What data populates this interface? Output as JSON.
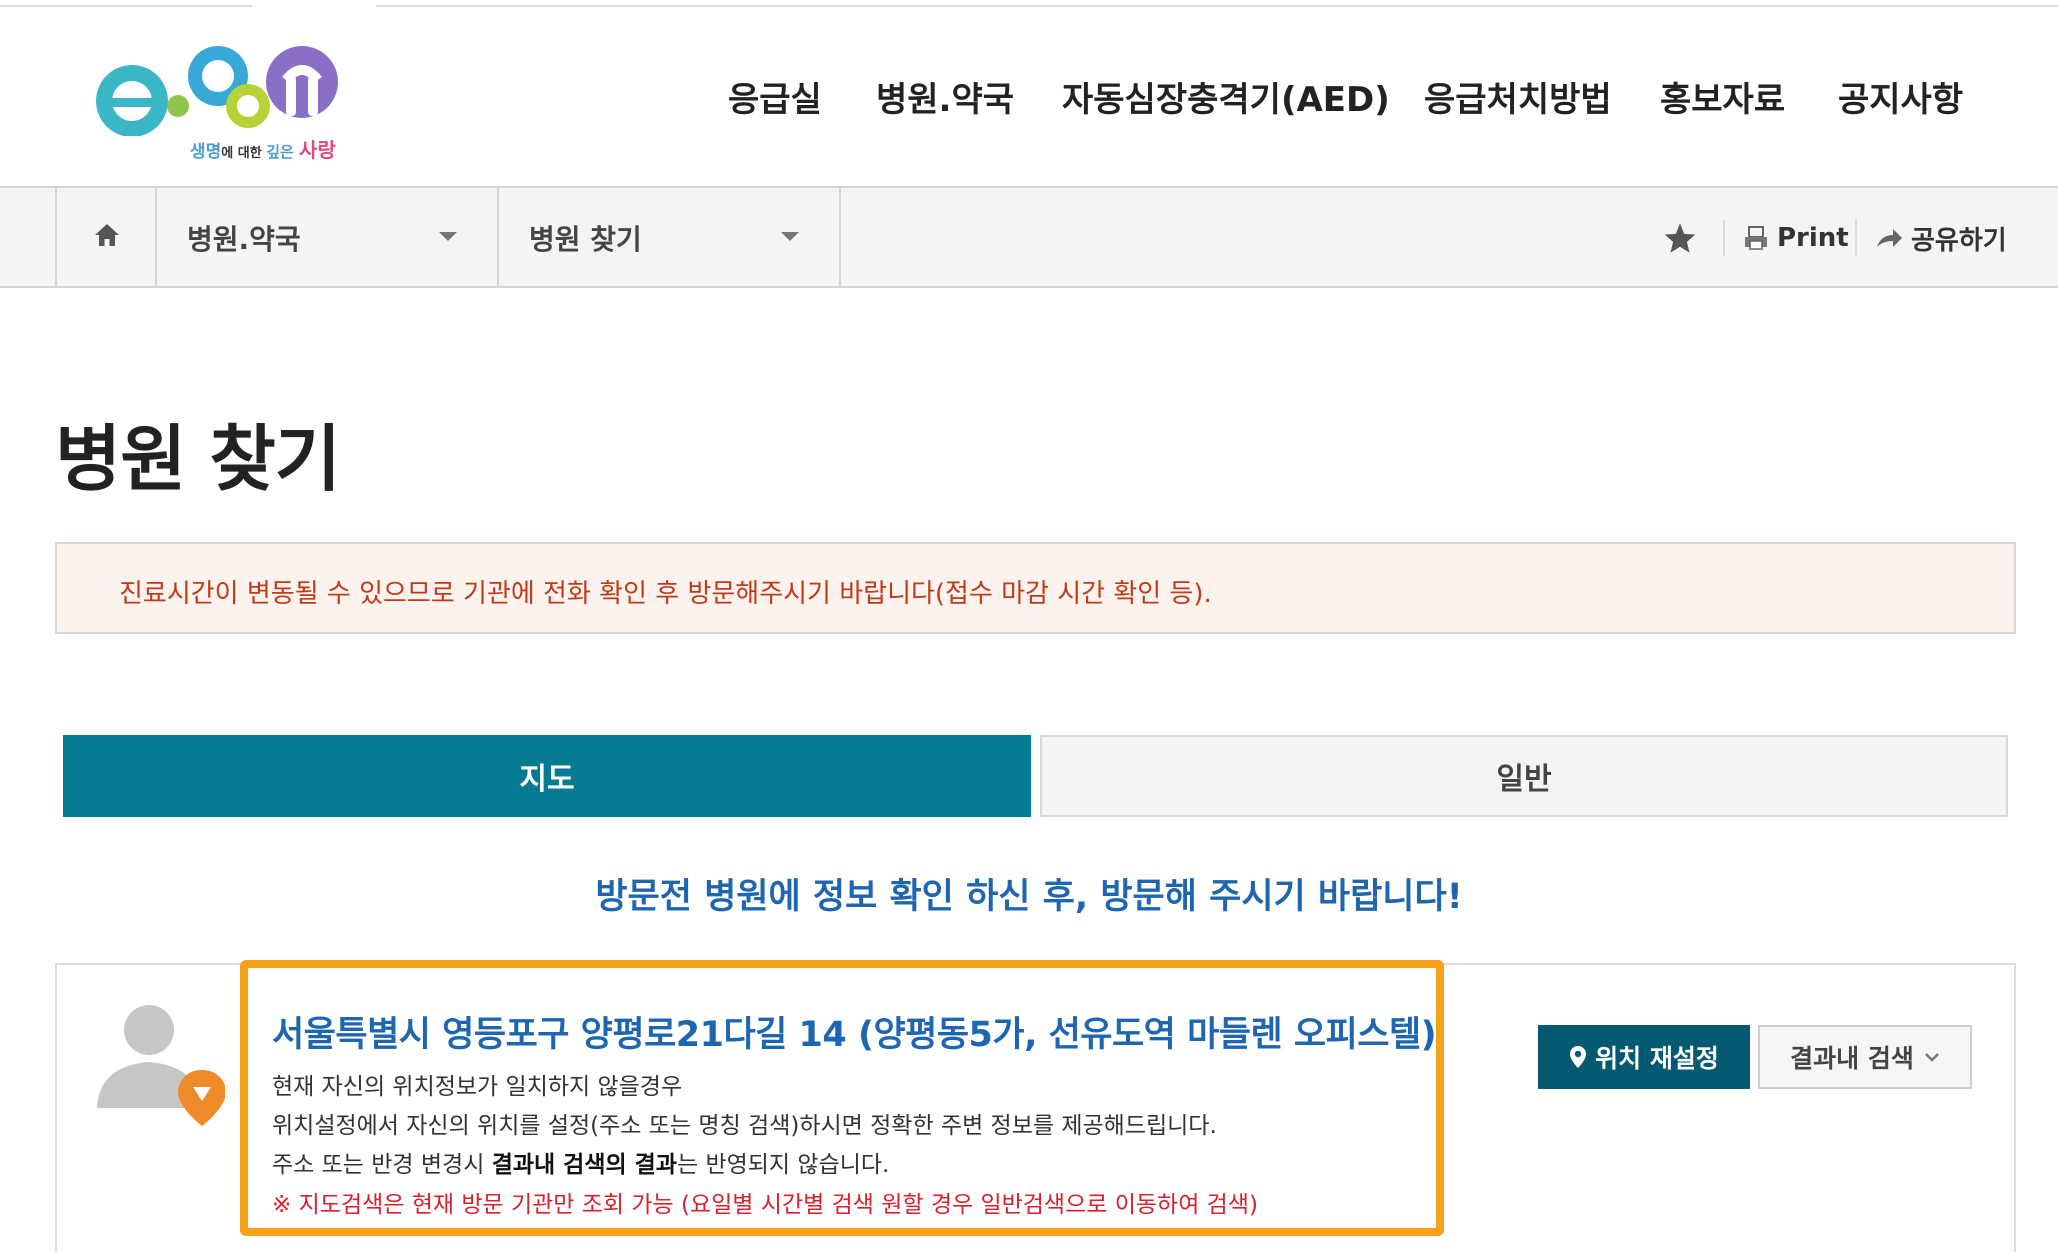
{
  "logo": {
    "tagline_part1": "생명",
    "tagline_part2": "에 대한 ",
    "tagline_part3": "깊은 ",
    "tagline_part4": "사랑"
  },
  "gnb": {
    "items": [
      {
        "label": "응급실"
      },
      {
        "label": "병원.약국"
      },
      {
        "label": "자동심장충격기(AED)"
      },
      {
        "label": "응급처치방법"
      },
      {
        "label": "홍보자료"
      },
      {
        "label": "공지사항"
      }
    ]
  },
  "subnav": {
    "depth1": "병원.약국",
    "depth2": "병원 찾기",
    "print_label": "Print",
    "share_label": "공유하기"
  },
  "page": {
    "title": "병원 찾기",
    "notice": "진료시간이 변동될 수 있으므로 기관에 전화 확인 후 방문해주시기 바랍니다(접수 마감 시간 확인 등)."
  },
  "tabs": {
    "map": "지도",
    "general": "일반"
  },
  "visit_message": "방문전 병원에 정보 확인 하신 후, 방문해 주시기 바랍니다!",
  "location": {
    "address": "서울특별시 영등포구 양평로21다길 14 (양평동5가, 선유도역 마들렌 오피스텔)",
    "line1": "현재 자신의 위치정보가 일치하지 않을경우",
    "line2": "위치설정에서 자신의 위치를 설정(주소 또는 명칭 검색)하시면 정확한 주변 정보를 제공해드립니다.",
    "line3_pre": "주소 또는 반경 변경시 ",
    "line3_bold": "결과내 검색의 결과",
    "line3_post": "는 반영되지 않습니다.",
    "warning": "※ 지도검색은 현재 방문 기관만 조회 가능 (요일별 시간별 검색 원할 경우 일반검색으로 이동하여 검색)",
    "reset_button": "위치 재설정",
    "search_button": "결과내 검색"
  },
  "colors": {
    "primary_tab": "#047a93",
    "dark_button": "#055a72",
    "link_blue": "#1f66b0",
    "notice_red": "#c03a19",
    "warning_red": "#d8212c",
    "highlight_orange": "#f6a219"
  }
}
